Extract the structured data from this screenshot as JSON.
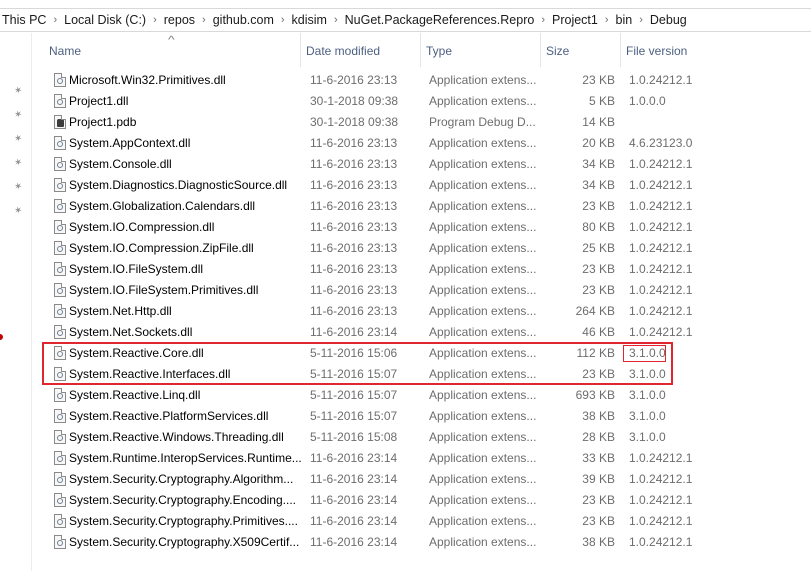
{
  "breadcrumb": [
    "This PC",
    "Local Disk (C:)",
    "repos",
    "github.com",
    "kdisim",
    "NuGet.PackageReferences.Repro",
    "Project1",
    "bin",
    "Debug"
  ],
  "columns": {
    "name": "Name",
    "date": "Date modified",
    "type": "Type",
    "size": "Size",
    "version": "File version"
  },
  "files": [
    {
      "name": "Microsoft.Win32.Primitives.dll",
      "date": "11-6-2016 23:13",
      "type": "Application extens...",
      "size": "23 KB",
      "version": "1.0.24212.1",
      "icon": "dll-file-icon"
    },
    {
      "name": "Project1.dll",
      "date": "30-1-2018 09:38",
      "type": "Application extens...",
      "size": "5 KB",
      "version": "1.0.0.0",
      "icon": "dll-file-icon"
    },
    {
      "name": "Project1.pdb",
      "date": "30-1-2018 09:38",
      "type": "Program Debug D...",
      "size": "14 KB",
      "version": "",
      "icon": "pdb-file-icon"
    },
    {
      "name": "System.AppContext.dll",
      "date": "11-6-2016 23:13",
      "type": "Application extens...",
      "size": "20 KB",
      "version": "4.6.23123.0",
      "icon": "dll-file-icon"
    },
    {
      "name": "System.Console.dll",
      "date": "11-6-2016 23:13",
      "type": "Application extens...",
      "size": "34 KB",
      "version": "1.0.24212.1",
      "icon": "dll-file-icon"
    },
    {
      "name": "System.Diagnostics.DiagnosticSource.dll",
      "date": "11-6-2016 23:13",
      "type": "Application extens...",
      "size": "34 KB",
      "version": "1.0.24212.1",
      "icon": "dll-file-icon"
    },
    {
      "name": "System.Globalization.Calendars.dll",
      "date": "11-6-2016 23:13",
      "type": "Application extens...",
      "size": "23 KB",
      "version": "1.0.24212.1",
      "icon": "dll-file-icon"
    },
    {
      "name": "System.IO.Compression.dll",
      "date": "11-6-2016 23:13",
      "type": "Application extens...",
      "size": "80 KB",
      "version": "1.0.24212.1",
      "icon": "dll-file-icon"
    },
    {
      "name": "System.IO.Compression.ZipFile.dll",
      "date": "11-6-2016 23:13",
      "type": "Application extens...",
      "size": "25 KB",
      "version": "1.0.24212.1",
      "icon": "dll-file-icon"
    },
    {
      "name": "System.IO.FileSystem.dll",
      "date": "11-6-2016 23:13",
      "type": "Application extens...",
      "size": "23 KB",
      "version": "1.0.24212.1",
      "icon": "dll-file-icon"
    },
    {
      "name": "System.IO.FileSystem.Primitives.dll",
      "date": "11-6-2016 23:13",
      "type": "Application extens...",
      "size": "23 KB",
      "version": "1.0.24212.1",
      "icon": "dll-file-icon"
    },
    {
      "name": "System.Net.Http.dll",
      "date": "11-6-2016 23:13",
      "type": "Application extens...",
      "size": "264 KB",
      "version": "1.0.24212.1",
      "icon": "dll-file-icon"
    },
    {
      "name": "System.Net.Sockets.dll",
      "date": "11-6-2016 23:14",
      "type": "Application extens...",
      "size": "46 KB",
      "version": "1.0.24212.1",
      "icon": "dll-file-icon"
    },
    {
      "name": "System.Reactive.Core.dll",
      "date": "5-11-2016 15:06",
      "type": "Application extens...",
      "size": "112 KB",
      "version": "3.1.0.0",
      "icon": "dll-file-icon"
    },
    {
      "name": "System.Reactive.Interfaces.dll",
      "date": "5-11-2016 15:07",
      "type": "Application extens...",
      "size": "23 KB",
      "version": "3.1.0.0",
      "icon": "dll-file-icon"
    },
    {
      "name": "System.Reactive.Linq.dll",
      "date": "5-11-2016 15:07",
      "type": "Application extens...",
      "size": "693 KB",
      "version": "3.1.0.0",
      "icon": "dll-file-icon"
    },
    {
      "name": "System.Reactive.PlatformServices.dll",
      "date": "5-11-2016 15:07",
      "type": "Application extens...",
      "size": "38 KB",
      "version": "3.1.0.0",
      "icon": "dll-file-icon"
    },
    {
      "name": "System.Reactive.Windows.Threading.dll",
      "date": "5-11-2016 15:08",
      "type": "Application extens...",
      "size": "28 KB",
      "version": "3.1.0.0",
      "icon": "dll-file-icon"
    },
    {
      "name": "System.Runtime.InteropServices.Runtime...",
      "date": "11-6-2016 23:14",
      "type": "Application extens...",
      "size": "33 KB",
      "version": "1.0.24212.1",
      "icon": "dll-file-icon"
    },
    {
      "name": "System.Security.Cryptography.Algorithm...",
      "date": "11-6-2016 23:14",
      "type": "Application extens...",
      "size": "39 KB",
      "version": "1.0.24212.1",
      "icon": "dll-file-icon"
    },
    {
      "name": "System.Security.Cryptography.Encoding....",
      "date": "11-6-2016 23:14",
      "type": "Application extens...",
      "size": "23 KB",
      "version": "1.0.24212.1",
      "icon": "dll-file-icon"
    },
    {
      "name": "System.Security.Cryptography.Primitives....",
      "date": "11-6-2016 23:14",
      "type": "Application extens...",
      "size": "23 KB",
      "version": "1.0.24212.1",
      "icon": "dll-file-icon"
    },
    {
      "name": "System.Security.Cryptography.X509Certif...",
      "date": "11-6-2016 23:14",
      "type": "Application extens...",
      "size": "38 KB",
      "version": "1.0.24212.1",
      "icon": "dll-file-icon"
    }
  ],
  "quick_access_pins": 6,
  "colors": {
    "highlight": "#e0262f",
    "header_text": "#4d6082",
    "detail_text": "#6d6d6d"
  }
}
